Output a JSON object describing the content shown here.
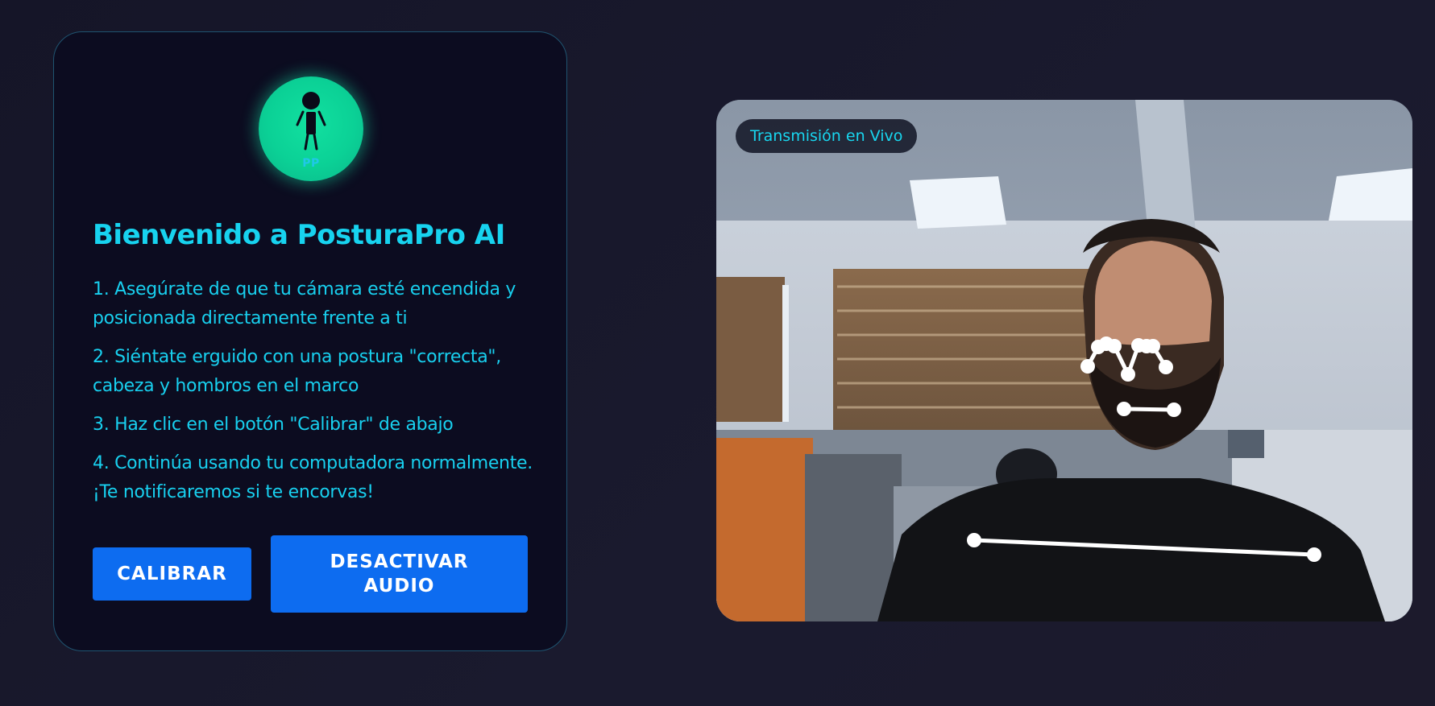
{
  "app": {
    "logo_icon": "person-posture-icon",
    "logo_initials": "PP",
    "title": "Bienvenido a PosturaPro AI"
  },
  "instructions": {
    "steps": [
      "1. Asegúrate de que tu cámara esté encendida y posicionada directamente frente a ti",
      "2. Siéntate erguido con una postura \"correcta\", cabeza y hombros en el marco",
      "3. Haz clic en el botón \"Calibrar\" de abajo",
      "4. Continúa usando tu computadora normalmente. ¡Te notificaremos si te encorvas!"
    ]
  },
  "actions": {
    "calibrate_label": "CALIBRAR",
    "audio_label": "DESACTIVAR AUDIO"
  },
  "video": {
    "badge_label": "Transmisión en Vivo"
  },
  "colors": {
    "accent": "#17d3ef",
    "button": "#0d6cf0",
    "logo": "#0bd196",
    "card_bg": "#0c0c20",
    "page_bg": "#1a1a2e"
  }
}
